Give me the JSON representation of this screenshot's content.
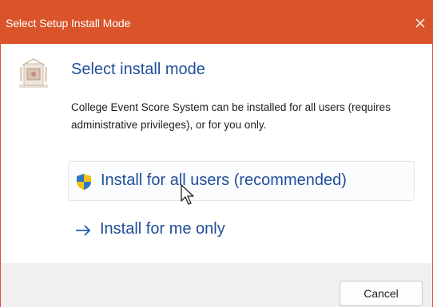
{
  "window": {
    "title": "Select Setup Install Mode",
    "close_icon": "close-icon",
    "title_bar_color": "#d9542a"
  },
  "header": {
    "icon": "setup-installer-icon",
    "heading": "Select install mode"
  },
  "description": "College Event Score System can be installed for all users (requires administrative privileges), or for you only.",
  "options": [
    {
      "label": "Install for all users (recommended)",
      "icon": "uac-shield-icon",
      "hovered": true
    },
    {
      "label": "Install for me only",
      "icon": "arrow-right-icon",
      "hovered": false
    }
  ],
  "footer": {
    "cancel_label": "Cancel"
  },
  "colors": {
    "accent_text": "#1f4e9a",
    "footer_bg": "#f0f0f0"
  }
}
